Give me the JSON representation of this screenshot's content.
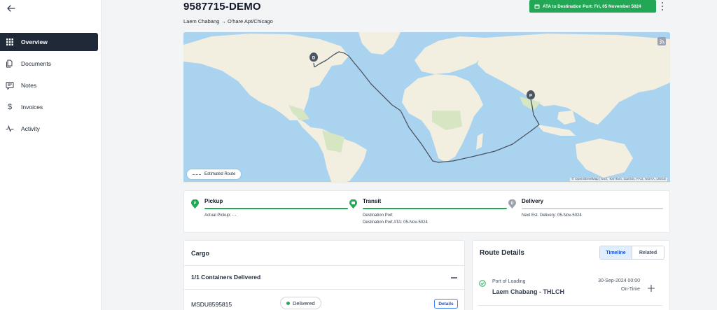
{
  "header": {
    "title": "9587715-DEMO",
    "route": "Laem Chabang → O'hare Apt/Chicago",
    "ata_badge": "ATA to Destination Port: Fri, 05 November 5024"
  },
  "sidebar": {
    "items": [
      {
        "label": "Overview",
        "icon": "grid-icon",
        "active": true
      },
      {
        "label": "Documents",
        "icon": "documents-icon",
        "active": false
      },
      {
        "label": "Notes",
        "icon": "notes-icon",
        "active": false
      },
      {
        "label": "Invoices",
        "icon": "dollar-icon",
        "active": false
      },
      {
        "label": "Activity",
        "icon": "activity-icon",
        "active": false
      }
    ]
  },
  "map": {
    "legend": "Estimated Route",
    "attribution": "© OpenStreetMap | Esri, TomTom, Garmin, FAO, NOAA, USGS",
    "markers": [
      "D",
      "P"
    ]
  },
  "progress": {
    "stages": [
      {
        "name": "Pickup",
        "line1": "Actual Pickup: - -",
        "line2": "",
        "status": "complete"
      },
      {
        "name": "Transit",
        "line1": "Destination Port",
        "line2": "Destination Port ATA: 05-Nov-5024",
        "status": "complete"
      },
      {
        "name": "Delivery",
        "line1": "Next Est. Delivery: 05-Nov-5024",
        "line2": "",
        "status": "pending"
      }
    ]
  },
  "cargo": {
    "title": "Cargo",
    "containers_summary": "1/1 Containers Delivered",
    "container_number": "MSDU8595815",
    "status": "Delivered",
    "details_label": "Details"
  },
  "route_details": {
    "title": "Route Details",
    "tabs": [
      "Timeline",
      "Related"
    ],
    "active_tab": "Timeline",
    "event": {
      "label": "Port of Loading",
      "name": "Laem Chabang - THLCH",
      "date": "30-Sep-2024 00:00",
      "status": "On-Time"
    }
  },
  "colors": {
    "brand_green": "#22a755",
    "sidebar_active": "#1f2937",
    "water": "#aad3f0",
    "land": "#f2efe0"
  }
}
